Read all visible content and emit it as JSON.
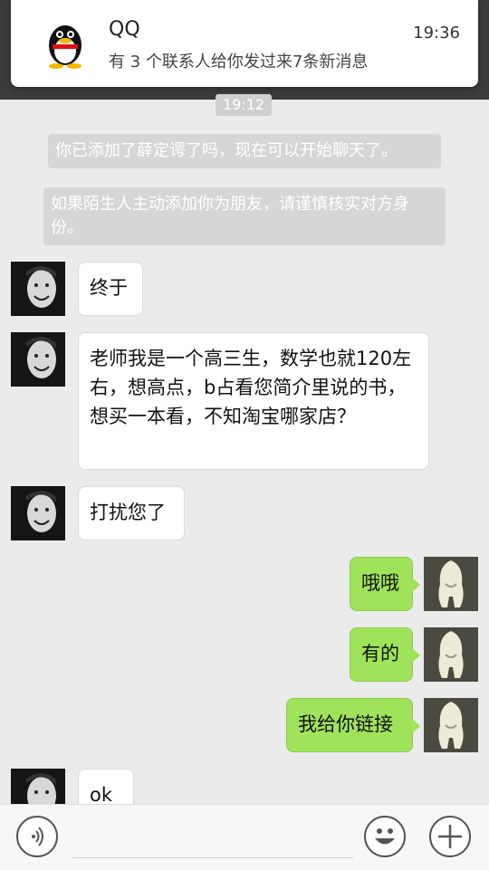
{
  "notification": {
    "app": "QQ",
    "message": "有 3 个联系人给你发过来7条新消息",
    "time": "19:36"
  },
  "chat": {
    "time_separator": "19:12",
    "system_messages": [
      "你已添加了薛定谔了吗，现在可以开始聊天了。",
      "如果陌生人主动添加你为朋友，请谨慎核实对方身份。"
    ],
    "messages": [
      {
        "side": "in",
        "text": "终于"
      },
      {
        "side": "in",
        "text": "老师我是一个高三生，数学也就120左右，想高点，b占看您简介里说的书，想买一本看，不知淘宝哪家店？"
      },
      {
        "side": "in",
        "text": "打扰您了"
      },
      {
        "side": "out",
        "text": "哦哦"
      },
      {
        "side": "out",
        "text": "有的"
      },
      {
        "side": "out",
        "text": "我给你链接"
      },
      {
        "side": "in",
        "text": "ok"
      }
    ]
  },
  "icons": {
    "voice": "voice-icon",
    "emoji": "emoji-icon",
    "plus": "plus-icon"
  },
  "colors": {
    "outgoing_bubble": "#9fe35a",
    "incoming_bubble": "#ffffff",
    "background": "#ebebeb"
  }
}
